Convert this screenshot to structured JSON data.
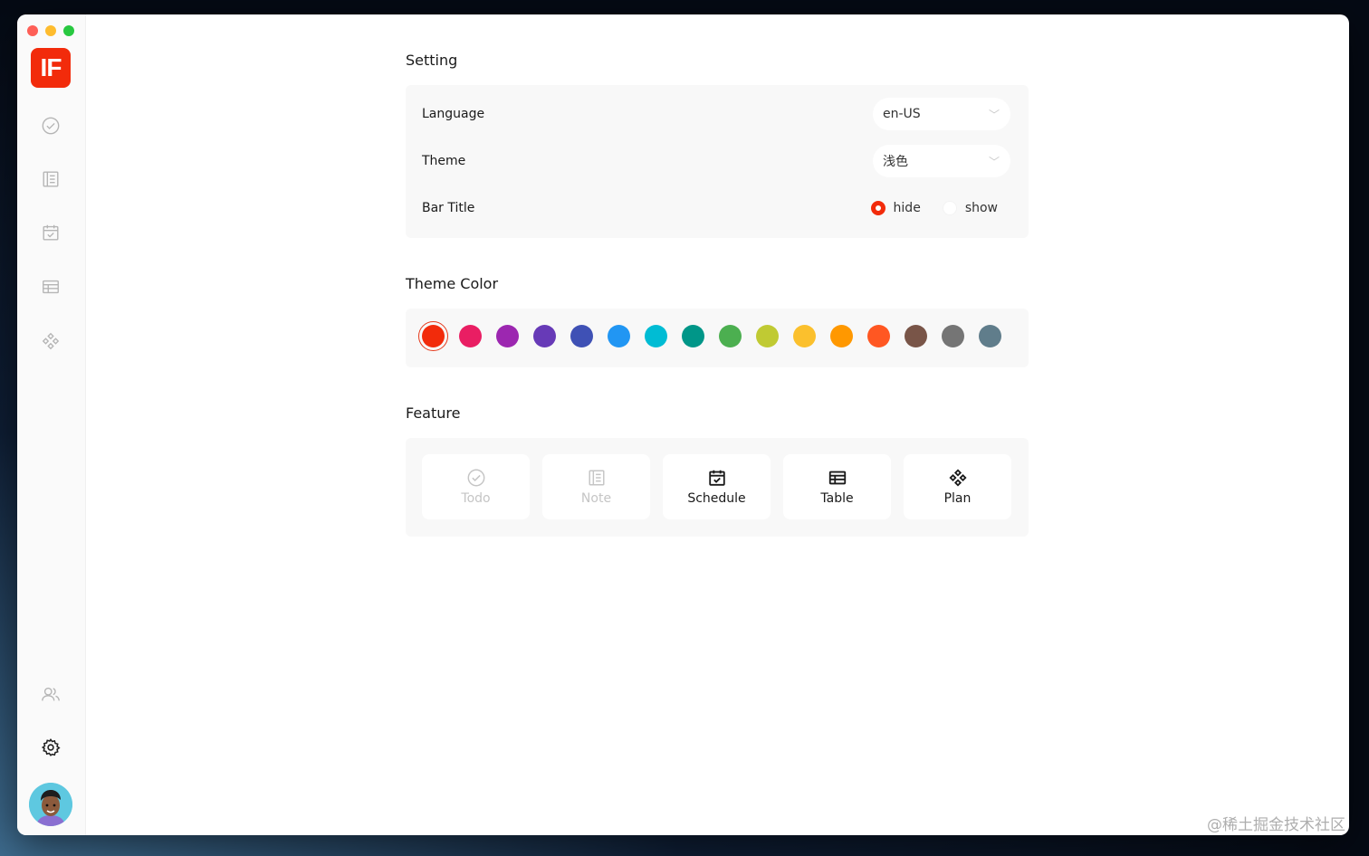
{
  "window": {
    "traffic_colors": [
      "#fe5f57",
      "#febc2e",
      "#28c840"
    ]
  },
  "sidebar": {
    "logo_text": "IF",
    "logo_color": "#f22b0b",
    "items": [
      {
        "name": "todo",
        "icon": "check-circle-icon"
      },
      {
        "name": "note",
        "icon": "note-icon"
      },
      {
        "name": "schedule",
        "icon": "calendar-check-icon"
      },
      {
        "name": "table",
        "icon": "table-icon"
      },
      {
        "name": "plan",
        "icon": "diamond-grid-icon"
      }
    ],
    "bottom_items": [
      {
        "name": "users",
        "icon": "users-icon"
      },
      {
        "name": "settings",
        "icon": "gear-icon",
        "active": true
      }
    ]
  },
  "setting": {
    "title": "Setting",
    "language": {
      "label": "Language",
      "value": "en-US"
    },
    "theme": {
      "label": "Theme",
      "value": "浅色"
    },
    "bar_title": {
      "label": "Bar Title",
      "options": [
        "hide",
        "show"
      ],
      "selected": "hide"
    }
  },
  "theme_color": {
    "title": "Theme Color",
    "colors": [
      "#f22b0b",
      "#e91e63",
      "#9c27b0",
      "#673ab7",
      "#3f51b5",
      "#2196f3",
      "#00bcd4",
      "#009688",
      "#4caf50",
      "#c0ca33",
      "#fbc02d",
      "#ff9800",
      "#ff5722",
      "#795548",
      "#757575",
      "#607d8b"
    ],
    "selected_index": 0
  },
  "feature": {
    "title": "Feature",
    "items": [
      {
        "label": "Todo",
        "icon": "check-circle-icon",
        "enabled": false
      },
      {
        "label": "Note",
        "icon": "note-icon",
        "enabled": false
      },
      {
        "label": "Schedule",
        "icon": "calendar-check-icon",
        "enabled": true
      },
      {
        "label": "Table",
        "icon": "table-icon",
        "enabled": true
      },
      {
        "label": "Plan",
        "icon": "diamond-grid-icon",
        "enabled": true
      }
    ]
  },
  "watermark": "@稀土掘金技术社区"
}
